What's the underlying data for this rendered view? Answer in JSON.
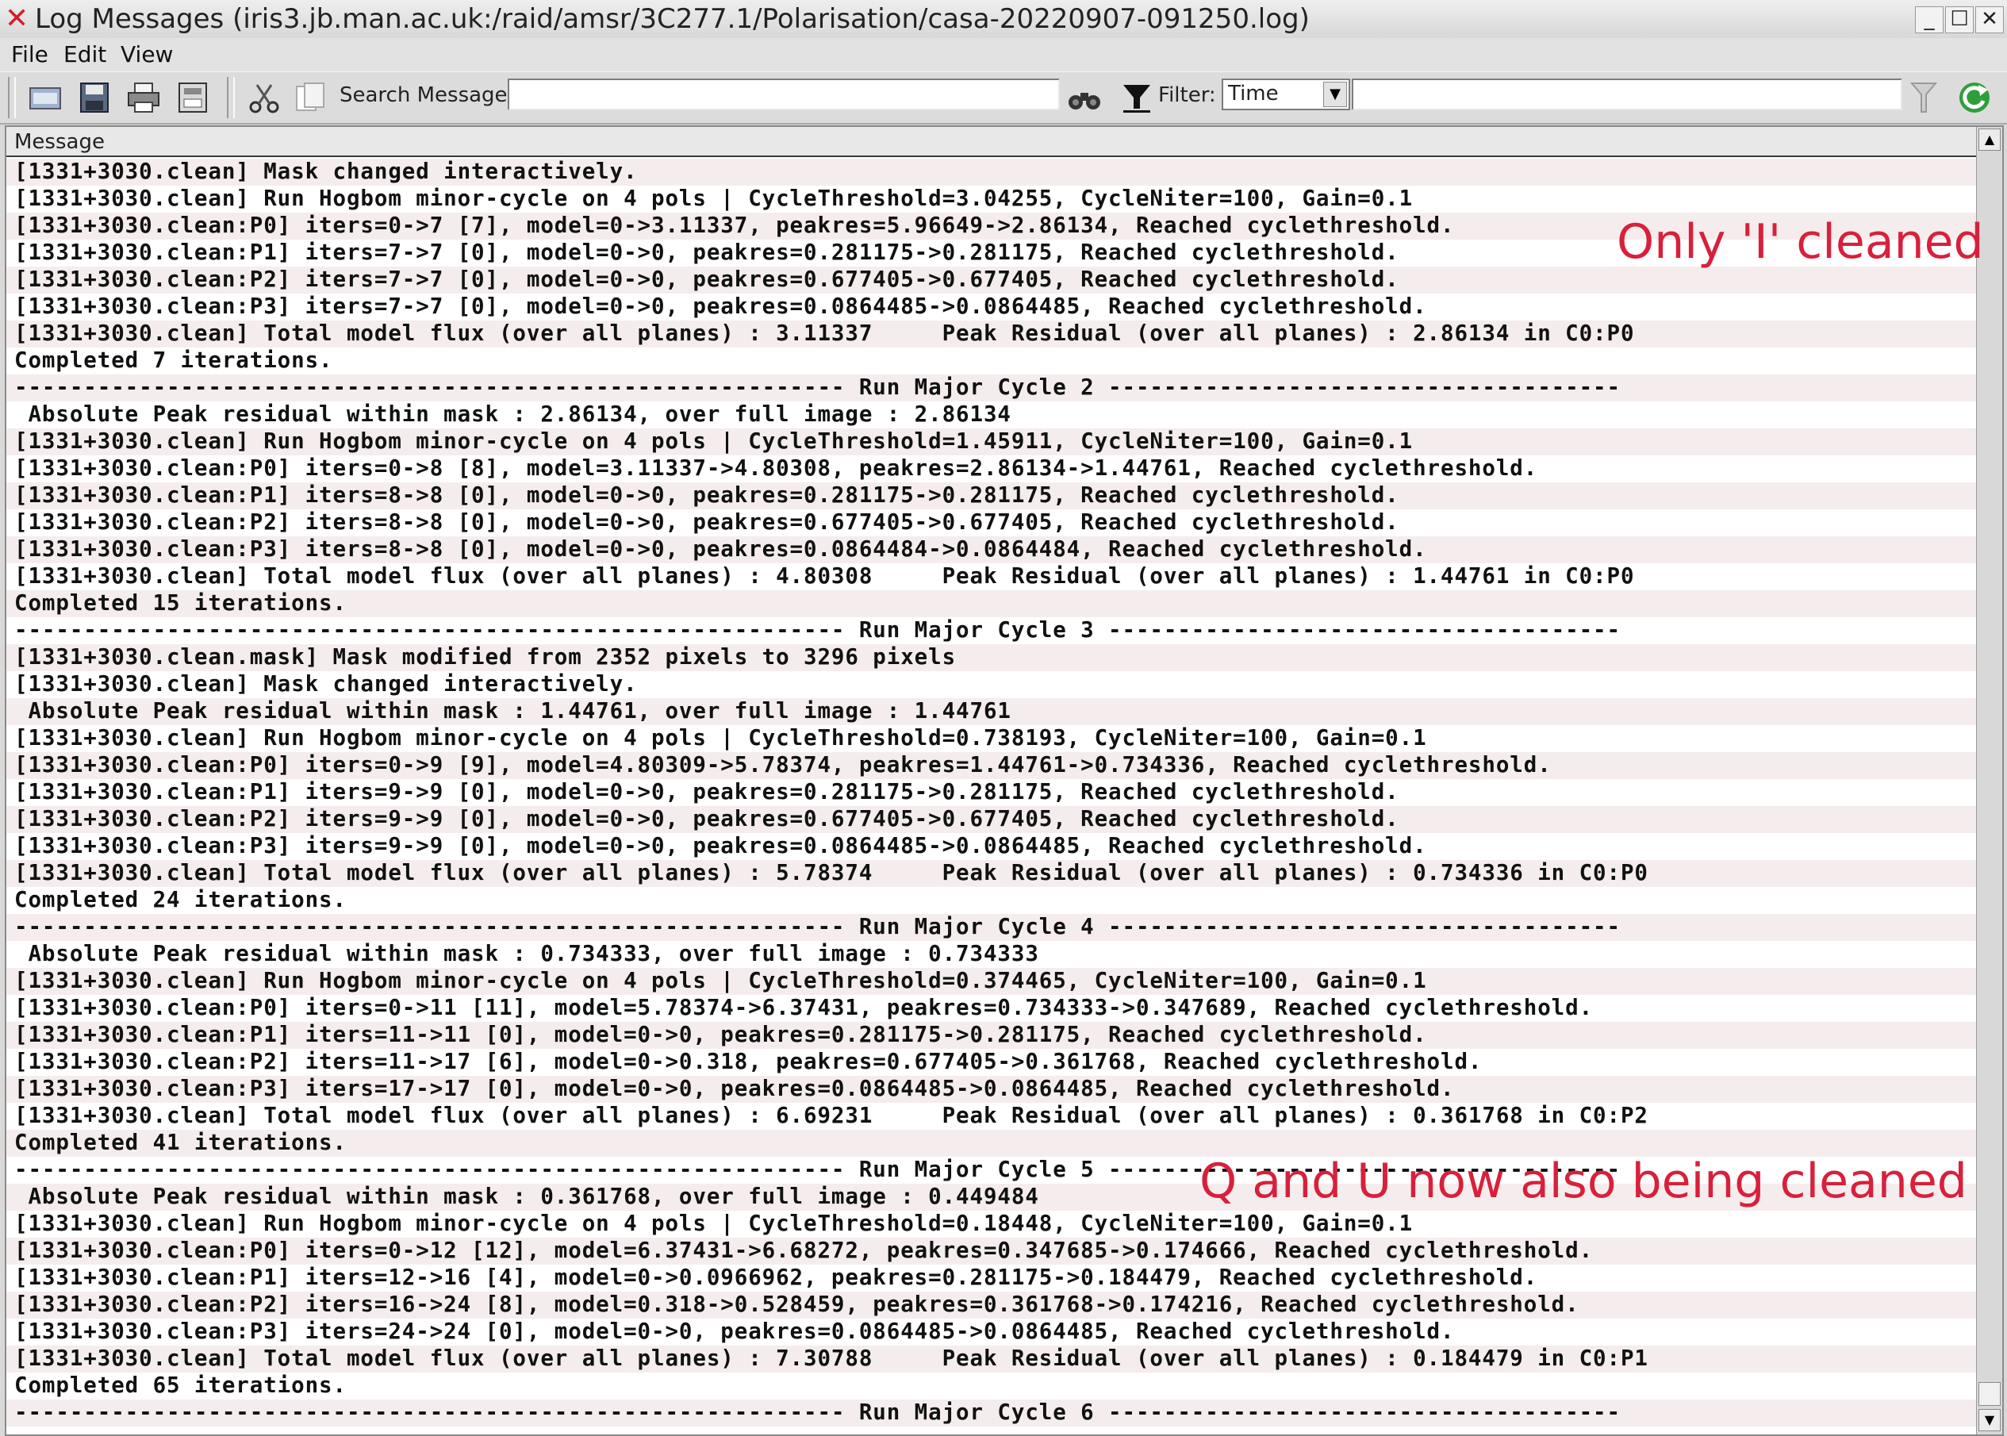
{
  "window": {
    "title": "Log Messages (iris3.jb.man.ac.uk:/raid/amsr/3C277.1/Polarisation/casa-20220907-091250.log)",
    "controls": [
      "_",
      "☐",
      "✕"
    ]
  },
  "menu": {
    "file": "File",
    "edit": "Edit",
    "view": "View"
  },
  "toolbar": {
    "search_label": "Search Message:",
    "search_value": "",
    "filter_label": "Filter:",
    "filter_selected": "Time",
    "filter_value": ""
  },
  "table": {
    "column_header": "Message"
  },
  "log_lines": [
    "[1331+3030.clean] Mask changed interactively.",
    "[1331+3030.clean] Run Hogbom minor-cycle on 4 pols | CycleThreshold=3.04255, CycleNiter=100, Gain=0.1",
    "[1331+3030.clean:P0] iters=0->7 [7], model=0->3.11337, peakres=5.96649->2.86134, Reached cyclethreshold.",
    "[1331+3030.clean:P1] iters=7->7 [0], model=0->0, peakres=0.281175->0.281175, Reached cyclethreshold.",
    "[1331+3030.clean:P2] iters=7->7 [0], model=0->0, peakres=0.677405->0.677405, Reached cyclethreshold.",
    "[1331+3030.clean:P3] iters=7->7 [0], model=0->0, peakres=0.0864485->0.0864485, Reached cyclethreshold.",
    "[1331+3030.clean] Total model flux (over all planes) : 3.11337     Peak Residual (over all planes) : 2.86134 in C0:P0",
    "Completed 7 iterations.",
    "------------------------------------------------------------ Run Major Cycle 2 -------------------------------------",
    " Absolute Peak residual within mask : 2.86134, over full image : 2.86134",
    "[1331+3030.clean] Run Hogbom minor-cycle on 4 pols | CycleThreshold=1.45911, CycleNiter=100, Gain=0.1",
    "[1331+3030.clean:P0] iters=0->8 [8], model=3.11337->4.80308, peakres=2.86134->1.44761, Reached cyclethreshold.",
    "[1331+3030.clean:P1] iters=8->8 [0], model=0->0, peakres=0.281175->0.281175, Reached cyclethreshold.",
    "[1331+3030.clean:P2] iters=8->8 [0], model=0->0, peakres=0.677405->0.677405, Reached cyclethreshold.",
    "[1331+3030.clean:P3] iters=8->8 [0], model=0->0, peakres=0.0864484->0.0864484, Reached cyclethreshold.",
    "[1331+3030.clean] Total model flux (over all planes) : 4.80308     Peak Residual (over all planes) : 1.44761 in C0:P0",
    "Completed 15 iterations.",
    "------------------------------------------------------------ Run Major Cycle 3 -------------------------------------",
    "[1331+3030.clean.mask] Mask modified from 2352 pixels to 3296 pixels",
    "[1331+3030.clean] Mask changed interactively.",
    " Absolute Peak residual within mask : 1.44761, over full image : 1.44761",
    "[1331+3030.clean] Run Hogbom minor-cycle on 4 pols | CycleThreshold=0.738193, CycleNiter=100, Gain=0.1",
    "[1331+3030.clean:P0] iters=0->9 [9], model=4.80309->5.78374, peakres=1.44761->0.734336, Reached cyclethreshold.",
    "[1331+3030.clean:P1] iters=9->9 [0], model=0->0, peakres=0.281175->0.281175, Reached cyclethreshold.",
    "[1331+3030.clean:P2] iters=9->9 [0], model=0->0, peakres=0.677405->0.677405, Reached cyclethreshold.",
    "[1331+3030.clean:P3] iters=9->9 [0], model=0->0, peakres=0.0864485->0.0864485, Reached cyclethreshold.",
    "[1331+3030.clean] Total model flux (over all planes) : 5.78374     Peak Residual (over all planes) : 0.734336 in C0:P0",
    "Completed 24 iterations.",
    "------------------------------------------------------------ Run Major Cycle 4 -------------------------------------",
    " Absolute Peak residual within mask : 0.734333, over full image : 0.734333",
    "[1331+3030.clean] Run Hogbom minor-cycle on 4 pols | CycleThreshold=0.374465, CycleNiter=100, Gain=0.1",
    "[1331+3030.clean:P0] iters=0->11 [11], model=5.78374->6.37431, peakres=0.734333->0.347689, Reached cyclethreshold.",
    "[1331+3030.clean:P1] iters=11->11 [0], model=0->0, peakres=0.281175->0.281175, Reached cyclethreshold.",
    "[1331+3030.clean:P2] iters=11->17 [6], model=0->0.318, peakres=0.677405->0.361768, Reached cyclethreshold.",
    "[1331+3030.clean:P3] iters=17->17 [0], model=0->0, peakres=0.0864485->0.0864485, Reached cyclethreshold.",
    "[1331+3030.clean] Total model flux (over all planes) : 6.69231     Peak Residual (over all planes) : 0.361768 in C0:P2",
    "Completed 41 iterations.",
    "------------------------------------------------------------ Run Major Cycle 5 -------------------------------------",
    " Absolute Peak residual within mask : 0.361768, over full image : 0.449484",
    "[1331+3030.clean] Run Hogbom minor-cycle on 4 pols | CycleThreshold=0.18448, CycleNiter=100, Gain=0.1",
    "[1331+3030.clean:P0] iters=0->12 [12], model=6.37431->6.68272, peakres=0.347685->0.174666, Reached cyclethreshold.",
    "[1331+3030.clean:P1] iters=12->16 [4], model=0->0.0966962, peakres=0.281175->0.184479, Reached cyclethreshold.",
    "[1331+3030.clean:P2] iters=16->24 [8], model=0.318->0.528459, peakres=0.361768->0.174216, Reached cyclethreshold.",
    "[1331+3030.clean:P3] iters=24->24 [0], model=0->0, peakres=0.0864485->0.0864485, Reached cyclethreshold.",
    "[1331+3030.clean] Total model flux (over all planes) : 7.30788     Peak Residual (over all planes) : 0.184479 in C0:P1",
    "Completed 65 iterations.",
    "------------------------------------------------------------ Run Major Cycle 6 -------------------------------------"
  ],
  "annotations": {
    "only_i": "Only 'I' cleaned",
    "q_and_u": "Q and U now also being cleaned",
    "color": "#d8203c"
  },
  "icons": [
    "close-x-icon",
    "open-icon",
    "save-icon",
    "print-icon",
    "export-icon",
    "cut-icon",
    "copy-icon",
    "binoculars-icon",
    "filter-funnel-icon",
    "clear-filter-icon",
    "refresh-icon"
  ]
}
